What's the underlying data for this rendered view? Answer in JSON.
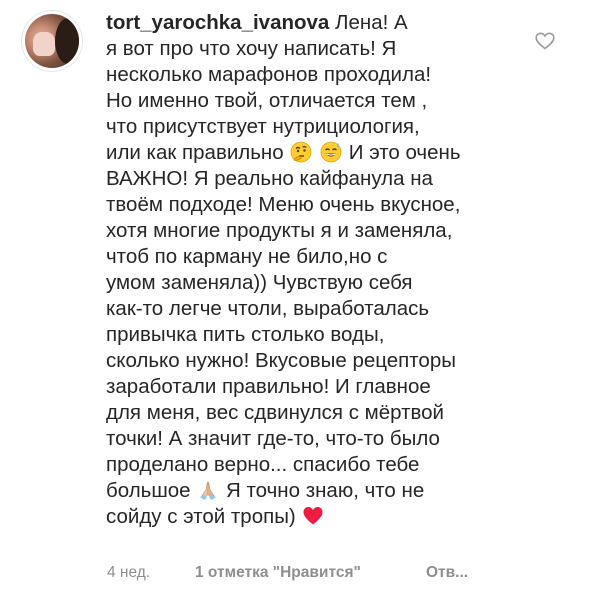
{
  "comment": {
    "username": "tort_yarochka_ivanova",
    "lines": [
      "Лена! А",
      "я вот про что хочу написать! Я",
      "несколько марафонов проходила!",
      "Но именно твой, отличается тем ,",
      "что присутствует нутрициология,",
      "или как правильно",
      "И это очень",
      "ВАЖНО! Я реально кайфанула на",
      "твоём подходе! Меню очень вкусное,",
      "хотя многие продукты я и заменяла,",
      "чтоб по карману не било,но с",
      "умом заменяла)) Чувствую себя",
      "как-то легче чтоли, выработалась",
      "привычка пить столько воды,",
      "сколько нужно! Вкусовые рецепторы",
      "заработали правильно! И главное",
      "для меня, вес сдвинулся с мёртвой",
      "точки! А значит где-то, что-то было",
      "проделано верно... спасибо тебе",
      "большое",
      "Я точно знаю, что не",
      "сойду с этой тропы)"
    ],
    "emoji": {
      "thinking": "thinking-face-emoji",
      "sweat_smile": "grinning-face-with-sweat-emoji",
      "pray": "folded-hands-emoji",
      "heart": "red-heart-emoji"
    }
  },
  "meta": {
    "time": "4 нед.",
    "likes": "1 отметка \"Нравится\"",
    "reply": "Отв..."
  },
  "colors": {
    "text": "#262626",
    "muted": "#8e8e8e",
    "heart": "#ed1c40"
  }
}
